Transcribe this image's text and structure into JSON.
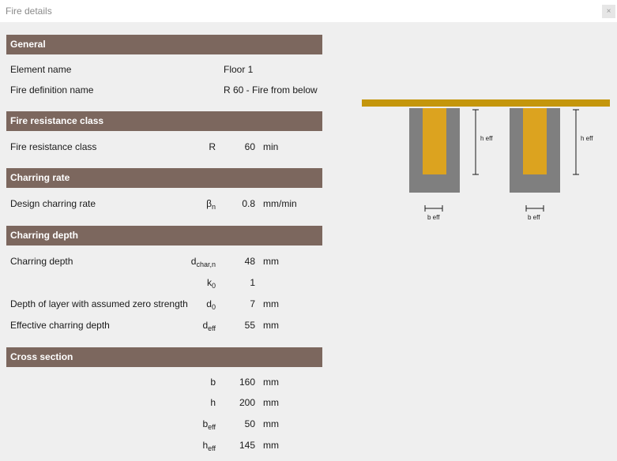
{
  "window": {
    "title": "Fire details",
    "close_glyph": "×"
  },
  "sections": {
    "general": "General",
    "fire_resistance_class": "Fire resistance class",
    "charring_rate": "Charring rate",
    "charring_depth": "Charring depth",
    "cross_section": "Cross section"
  },
  "general": {
    "element_name_label": "Element name",
    "element_name_value": "Floor 1",
    "fire_definition_label": "Fire definition name",
    "fire_definition_value": "R 60 - Fire from below"
  },
  "fire_resistance": {
    "label": "Fire resistance class",
    "symbol": "R",
    "value": "60",
    "unit": "min"
  },
  "charring_rate": {
    "label": "Design charring rate",
    "symbol_base": "β",
    "symbol_sub": "n",
    "value": "0.8",
    "unit": "mm/min"
  },
  "charring_depth": {
    "dchar_label": "Charring depth",
    "dchar_sym": "d",
    "dchar_sub": "char,n",
    "dchar_value": "48",
    "dchar_unit": "mm",
    "k0_sym": "k",
    "k0_sub": "0",
    "k0_value": "1",
    "d0_label": "Depth of layer with assumed zero strength",
    "d0_sym": "d",
    "d0_sub": "0",
    "d0_value": "7",
    "d0_unit": "mm",
    "deff_label": "Effective charring depth",
    "deff_sym": "d",
    "deff_sub": "eff",
    "deff_value": "55",
    "deff_unit": "mm"
  },
  "cross_section": {
    "b_sym": "b",
    "b_value": "160",
    "b_unit": "mm",
    "h_sym": "h",
    "h_value": "200",
    "h_unit": "mm",
    "beff_sym": "b",
    "beff_sub": "eff",
    "beff_value": "50",
    "beff_unit": "mm",
    "heff_sym": "h",
    "heff_sub": "eff",
    "heff_value": "145",
    "heff_unit": "mm"
  },
  "diagram": {
    "heff_label": "h eff",
    "beff_label": "b eff",
    "colors": {
      "slab": "#c4960c",
      "beam": "#7f7f7f",
      "core": "#dca31f"
    }
  }
}
